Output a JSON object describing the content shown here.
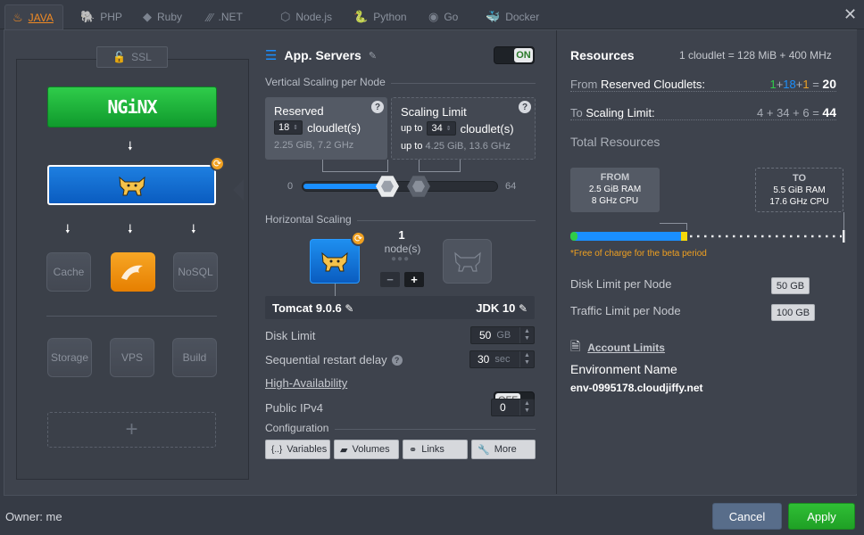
{
  "tabs": [
    {
      "label": "JAVA",
      "icon": "java-icon"
    },
    {
      "label": "PHP",
      "icon": "php-icon"
    },
    {
      "label": "Ruby",
      "icon": "ruby-icon"
    },
    {
      "label": ".NET",
      "icon": "dotnet-icon"
    },
    {
      "label": "Node.js",
      "icon": "nodejs-icon"
    },
    {
      "label": "Python",
      "icon": "python-icon"
    },
    {
      "label": "Go",
      "icon": "go-icon"
    },
    {
      "label": "Docker",
      "icon": "docker-icon"
    }
  ],
  "topology": {
    "ssl": "SSL",
    "balancer": "NGiNX",
    "cache": "Cache",
    "nosql": "NoSQL",
    "storage": "Storage",
    "vps": "VPS",
    "build": "Build",
    "add": "+"
  },
  "appservers": {
    "title": "App. Servers",
    "toggle": "ON",
    "vertical_title": "Vertical Scaling per Node",
    "reserved": {
      "label": "Reserved",
      "value": "18",
      "unit": "cloudlet(s)",
      "info": "2.25 GiB, 7.2 GHz"
    },
    "limit": {
      "label": "Scaling Limit",
      "prefix": "up to",
      "value": "34",
      "unit": "cloudlet(s)",
      "info_prefix": "up to",
      "info": "4.25 GiB, 13.6 GHz"
    },
    "slider": {
      "min": "0",
      "max": "64",
      "reserved_value": 18,
      "limit_value": 34
    },
    "horizontal_title": "Horizontal Scaling",
    "nodes_count": "1",
    "nodes_label": "node(s)",
    "minus": "−",
    "plus": "+",
    "server": "Tomcat 9.0.6",
    "jdk": "JDK 10",
    "disk_limit": {
      "label": "Disk Limit",
      "value": "50",
      "unit": "GB"
    },
    "restart_delay": {
      "label": "Sequential restart delay",
      "value": "30",
      "unit": "sec"
    },
    "ha": {
      "label": "High-Availability",
      "toggle": "OFF"
    },
    "ipv4": {
      "label": "Public IPv4",
      "value": "0"
    },
    "configuration_title": "Configuration",
    "config_buttons": [
      "Variables",
      "Volumes",
      "Links",
      "More"
    ]
  },
  "resources": {
    "title": "Resources",
    "cloudlet_def": "1 cloudlet = 128 MiB + 400 MHz",
    "reserved_label_prefix": "From",
    "reserved_label": "Reserved Cloudlets:",
    "reserved_parts": [
      "1",
      "+",
      "18",
      "+",
      "1",
      "="
    ],
    "reserved_total": "20",
    "limit_label_prefix": "To",
    "limit_label": "Scaling Limit:",
    "limit_expr": "4 + 34 + 6 =",
    "limit_total": "44",
    "total_title": "Total Resources",
    "from": {
      "title": "FROM",
      "ram": "2.5 GiB RAM",
      "cpu": "8 GHz CPU"
    },
    "to": {
      "title": "TO",
      "ram": "5.5 GiB RAM",
      "cpu": "17.6 GHz CPU"
    },
    "free_note": "*Free of charge for the beta period",
    "disk_label": "Disk Limit per Node",
    "disk_value": "50 GB",
    "traffic_label": "Traffic Limit per Node",
    "traffic_value": "100 GB",
    "account_limits": "Account Limits",
    "env_name_label": "Environment Name",
    "env_name": "env-0995178.cloudjiffy.net"
  },
  "footer": {
    "owner": "Owner: me",
    "cancel": "Cancel",
    "apply": "Apply"
  },
  "colors": {
    "accent": "#f08a24",
    "blue": "#1a8fff",
    "green": "#2fbf35",
    "yellow": "#f5d90a"
  }
}
